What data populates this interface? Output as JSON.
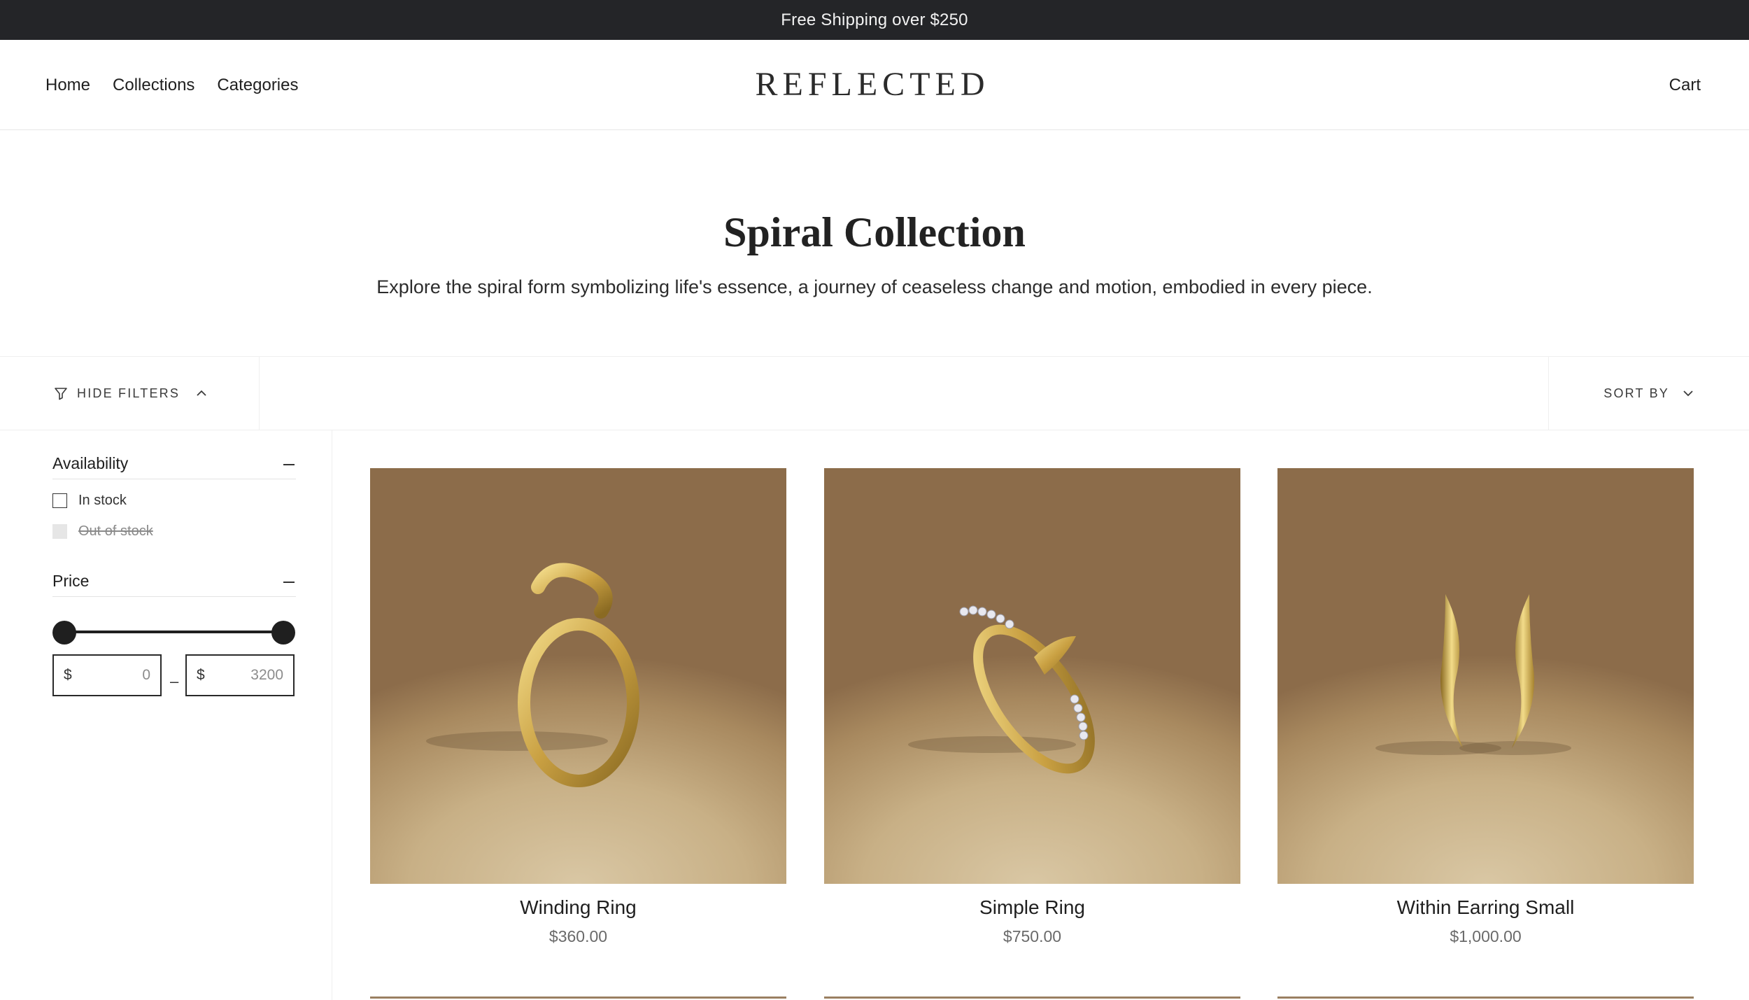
{
  "announcement": "Free Shipping over $250",
  "nav": {
    "home": "Home",
    "collections": "Collections",
    "categories": "Categories"
  },
  "brand": "REFLECTED",
  "cart": "Cart",
  "hero": {
    "title": "Spiral Collection",
    "description": "Explore the spiral form symbolizing life's essence, a journey of ceaseless change and motion, embodied in every piece."
  },
  "toolbar": {
    "hide_filters": "HIDE FILTERS",
    "sort_by": "SORT BY"
  },
  "filters": {
    "availability": {
      "title": "Availability",
      "options": [
        "In stock",
        "Out of stock"
      ]
    },
    "price": {
      "title": "Price",
      "currency": "$",
      "min": "0",
      "max": "3200",
      "range_separator": "–"
    }
  },
  "products": [
    {
      "name": "Winding Ring",
      "price": "$360.00"
    },
    {
      "name": "Simple Ring",
      "price": "$750.00"
    },
    {
      "name": "Within Earring Small",
      "price": "$1,000.00"
    }
  ],
  "colors": {
    "announcement_bg": "#242528",
    "product_bg": "#c8b086",
    "gold": "#d9b75a"
  }
}
